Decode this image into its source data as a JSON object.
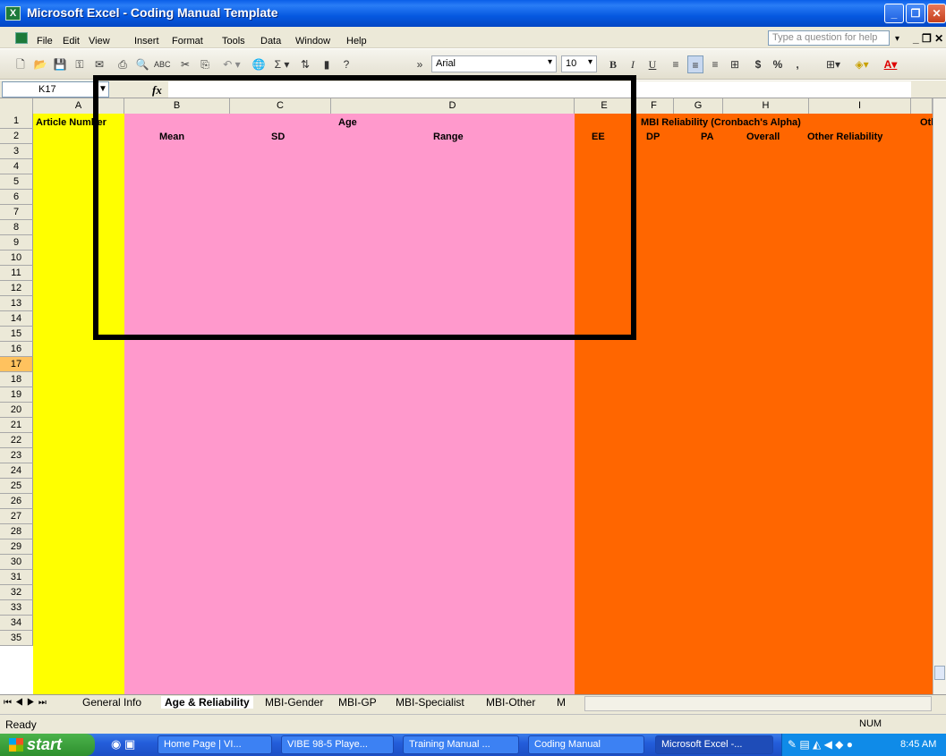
{
  "window": {
    "title": "Microsoft Excel - Coding Manual Template"
  },
  "menu": [
    "File",
    "Edit",
    "View",
    "Insert",
    "Format",
    "Tools",
    "Data",
    "Window",
    "Help"
  ],
  "help_placeholder": "Type a question for help",
  "toolbar": {
    "font": "Arial",
    "size": "10",
    "bold": "B",
    "italic": "I",
    "underline": "U",
    "currency": "$",
    "percent": "%",
    "comma": ","
  },
  "formula_bar": {
    "cell_ref": "K17",
    "fx": "fx",
    "value": ""
  },
  "columns": [
    "A",
    "B",
    "C",
    "D",
    "E",
    "F",
    "G",
    "H",
    "I"
  ],
  "rows": [
    "1",
    "2",
    "3",
    "4",
    "5",
    "6",
    "7",
    "8",
    "9",
    "10",
    "11",
    "12",
    "13",
    "14",
    "15",
    "16",
    "17",
    "18",
    "19",
    "20",
    "21",
    "22",
    "23",
    "24",
    "25",
    "26",
    "27",
    "28",
    "29",
    "30",
    "31",
    "32",
    "33",
    "34",
    "35"
  ],
  "active_row": "17",
  "cells": {
    "a1": "Article Number",
    "age": "Age",
    "mean": "Mean",
    "sd": "SD",
    "range": "Range",
    "ee": "EE",
    "mbi": "MBI Reliability (Cronbach's Alpha)",
    "dp": "DP",
    "pa": "PA",
    "overall": "Overall",
    "other_rel": "Other Reliability",
    "oth": "Oth"
  },
  "colors": {
    "yellow": "#ffff00",
    "pink": "#ff99cc",
    "orange": "#ff6600"
  },
  "sheet_tabs": [
    "General Info",
    "Age & Reliability",
    "MBI-Gender",
    "MBI-GP",
    "MBI-Specialist",
    "MBI-Other",
    "M"
  ],
  "active_tab": "Age & Reliability",
  "status": {
    "left": "Ready",
    "num": "NUM"
  },
  "taskbar": {
    "start": "start",
    "tasks": [
      "Home Page | VI...",
      "VIBE 98-5 Playe...",
      "Training Manual ...",
      "Coding Manual",
      "Microsoft Excel -..."
    ],
    "clock": "8:45 AM"
  }
}
